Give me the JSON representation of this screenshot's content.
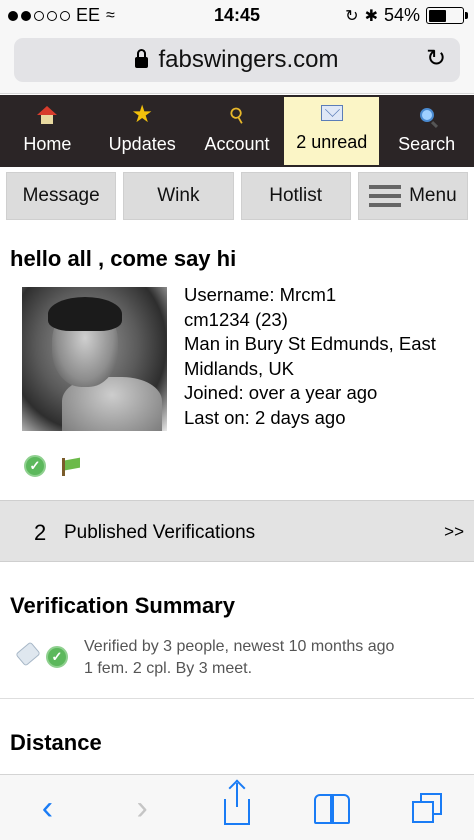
{
  "status_bar": {
    "carrier": "EE",
    "time": "14:45",
    "battery": "54%",
    "battery_level": 0.54
  },
  "browser": {
    "url": "fabswingers.com"
  },
  "nav": {
    "items": [
      {
        "label": "Home",
        "icon": "home-icon"
      },
      {
        "label": "Updates",
        "icon": "star-icon"
      },
      {
        "label": "Account",
        "icon": "key-icon"
      },
      {
        "label": "2 unread",
        "icon": "mail-icon",
        "active": true
      },
      {
        "label": "Search",
        "icon": "search-icon"
      }
    ]
  },
  "actions": {
    "message": "Message",
    "wink": "Wink",
    "hotlist": "Hotlist",
    "menu": "Menu"
  },
  "profile": {
    "headline": "hello all , come say hi",
    "username": "Username: Mrcm1",
    "alias": "cm1234 (23)",
    "location": "Man in Bury St Edmunds, East Midlands, UK",
    "joined": "Joined: over a year ago",
    "last_on": "Last on: 2 days ago"
  },
  "published": {
    "count": "2",
    "label": "Published Verifications",
    "arrow": ">>"
  },
  "verification": {
    "title": "Verification Summary",
    "line1": "Verified by 3 people, newest 10 months ago",
    "line2": "1 fem. 2 cpl. By 3 meet."
  },
  "distance": {
    "title": "Distance"
  },
  "colors": {
    "nav_bg": "#2b2526",
    "active_tab": "#fbf5c6",
    "ios_blue": "#1a7cf5",
    "verified_green": "#5cb85c"
  }
}
